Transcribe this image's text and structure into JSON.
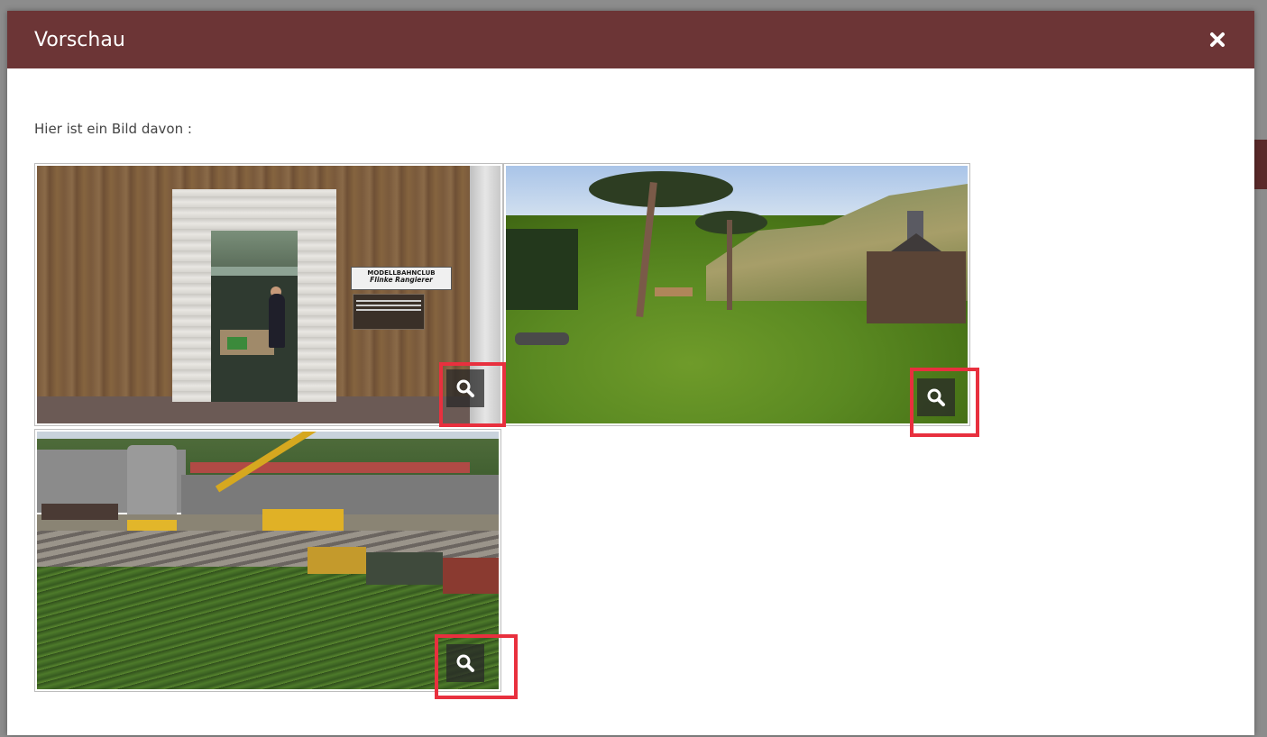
{
  "modal": {
    "title": "Vorschau",
    "close_icon": "close-icon",
    "intro_text": "Hier ist ein Bild davon :"
  },
  "gallery": {
    "images": [
      {
        "scene": "model-railway-club-entrance",
        "sign_line1": "MODELLBAHNCLUB",
        "sign_line2": "Flinke Rangierer",
        "zoom_icon": "search-icon"
      },
      {
        "scene": "mountain-meadow-chapel",
        "zoom_icon": "search-icon"
      },
      {
        "scene": "rail-yard-crane",
        "zoom_icon": "search-icon"
      }
    ]
  },
  "colors": {
    "header_bg": "#6c3536",
    "highlight": "#e8303e"
  }
}
